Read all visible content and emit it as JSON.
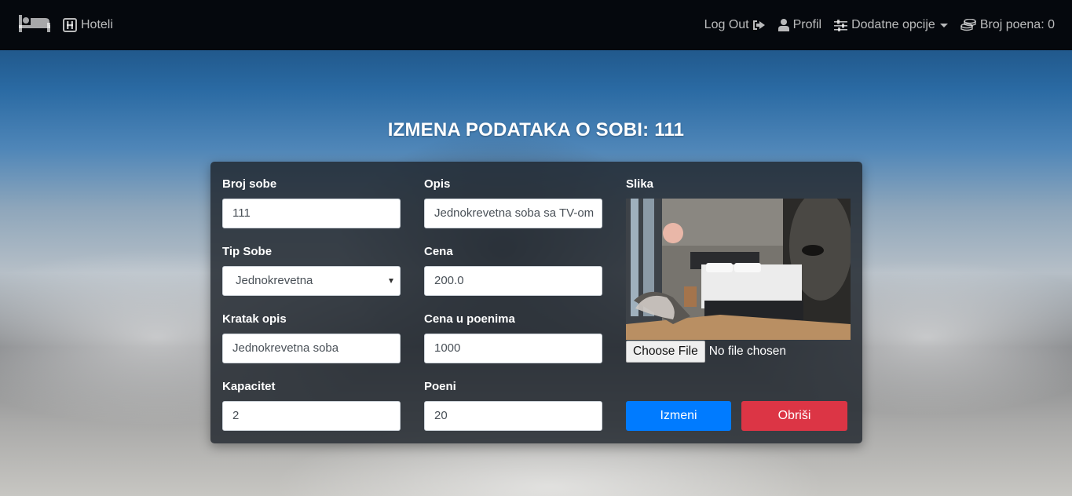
{
  "navbar": {
    "brand_icon": "bed-icon",
    "hotels_icon": "hotel-h-icon",
    "hotels_label": "Hoteli",
    "logout_label": "Log Out",
    "logout_icon": "sign-out-icon",
    "profile_icon": "user-icon",
    "profile_label": "Profil",
    "options_icon": "sliders-icon",
    "options_label": "Dodatne opcije",
    "points_icon": "coins-icon",
    "points_label": "Broj poena: 0"
  },
  "page": {
    "title": "IZMENA PODATAKA O SOBI: 111"
  },
  "form": {
    "room_number": {
      "label": "Broj sobe",
      "value": "111"
    },
    "room_type": {
      "label": "Tip Sobe",
      "value": "Jednokrevetna"
    },
    "short_description": {
      "label": "Kratak opis",
      "value": "Jednokrevetna soba"
    },
    "capacity": {
      "label": "Kapacitet",
      "value": "2"
    },
    "description": {
      "label": "Opis",
      "value": "Jednokrevetna soba sa TV-om"
    },
    "price": {
      "label": "Cena",
      "value": "200.0"
    },
    "price_points": {
      "label": "Cena u poenima",
      "value": "1000"
    },
    "points": {
      "label": "Poeni",
      "value": "20"
    },
    "image": {
      "label": "Slika",
      "choose_file_label": "Choose File",
      "file_status": "No file chosen"
    },
    "edit_button": "Izmeni",
    "delete_button": "Obriši"
  },
  "colors": {
    "navbar_bg": "#05080d",
    "primary": "#007bff",
    "danger": "#dc3545",
    "card_bg": "rgba(30,36,44,0.82)"
  }
}
